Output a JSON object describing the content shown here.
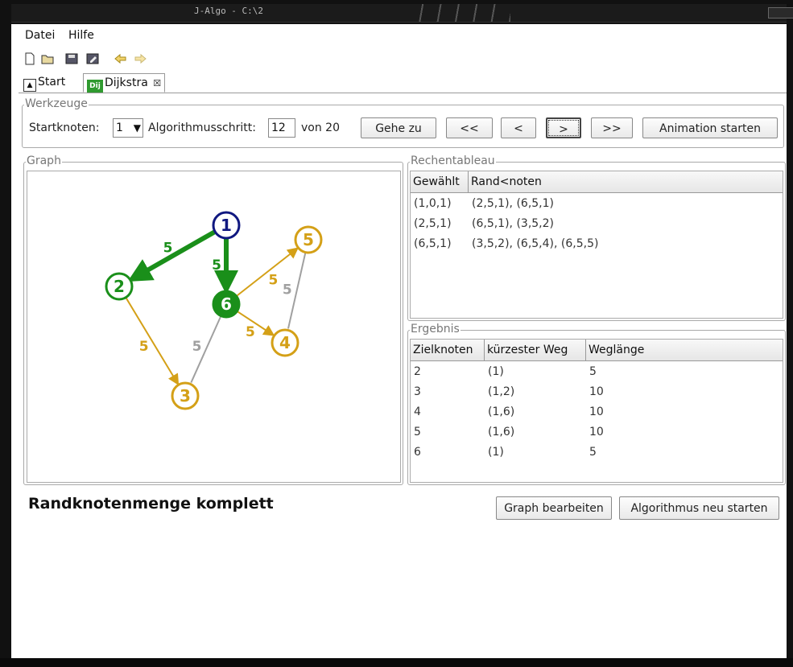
{
  "window": {
    "title": "J-Algo - C:\\2"
  },
  "menu": {
    "items": [
      "Datei",
      "Hilfe"
    ]
  },
  "toolbar": {
    "icons": [
      "new-file-icon",
      "open-folder-icon",
      "save-icon",
      "save-as-icon",
      "back-icon",
      "forward-icon"
    ]
  },
  "tabs": [
    {
      "label": "Start",
      "icon": "start-icon"
    },
    {
      "label": "Dijkstra",
      "icon_text": "Dij",
      "close": "☒"
    }
  ],
  "tools": {
    "legend": "Werkzeuge",
    "startknoten_label": "Startknoten:",
    "startknoten_value": "1",
    "schritt_label": "Algorithmusschritt:",
    "schritt_value": "12",
    "von_label": "von 20",
    "goto_label": "Gehe zu",
    "first_label": "<<",
    "prev_label": "<",
    "next_label": ">",
    "last_label": ">>",
    "animate_label": "Animation starten"
  },
  "graph": {
    "legend": "Graph",
    "colors": {
      "done": "#1a8f1a",
      "start": "#101880",
      "frontier": "#d4a017",
      "unvisited": "#a0a0a0"
    },
    "nodes": [
      {
        "id": "1",
        "state": "start"
      },
      {
        "id": "2",
        "state": "done"
      },
      {
        "id": "3",
        "state": "frontier"
      },
      {
        "id": "4",
        "state": "frontier"
      },
      {
        "id": "5",
        "state": "frontier"
      },
      {
        "id": "6",
        "state": "done-selected"
      }
    ],
    "edges": [
      {
        "from": "1",
        "to": "2",
        "weight": "5",
        "state": "done"
      },
      {
        "from": "1",
        "to": "6",
        "weight": "5",
        "state": "done"
      },
      {
        "from": "6",
        "to": "5",
        "weight": "5",
        "state": "frontier"
      },
      {
        "from": "6",
        "to": "4",
        "weight": "5",
        "state": "frontier"
      },
      {
        "from": "2",
        "to": "3",
        "weight": "5",
        "state": "frontier"
      },
      {
        "from": "6",
        "to": "3",
        "weight": "5",
        "state": "unvisited"
      },
      {
        "from": "5",
        "to": "4",
        "weight": "5",
        "state": "unvisited"
      }
    ]
  },
  "tableau": {
    "legend": "Rechentableau",
    "headers": [
      "Gewählt",
      "Rand<noten"
    ],
    "rows": [
      [
        "(1,0,1)",
        "(2,5,1), (6,5,1)"
      ],
      [
        "(2,5,1)",
        "(6,5,1), (3,5,2)"
      ],
      [
        "(6,5,1)",
        "(3,5,2), (6,5,4), (6,5,5)"
      ]
    ]
  },
  "result": {
    "legend": "Ergebnis",
    "headers": [
      "Zielknoten",
      "kürzester Weg",
      "Weglänge"
    ],
    "rows": [
      [
        "2",
        "(1)",
        "5"
      ],
      [
        "3",
        "(1,2)",
        "10"
      ],
      [
        "4",
        "(1,6)",
        "10"
      ],
      [
        "5",
        "(1,6)",
        "10"
      ],
      [
        "6",
        "(1)",
        "5"
      ]
    ]
  },
  "status": {
    "text": "Randknotenmenge komplett"
  },
  "actions": {
    "edit_graph_label": "Graph bearbeiten",
    "restart_label": "Algorithmus neu starten"
  }
}
